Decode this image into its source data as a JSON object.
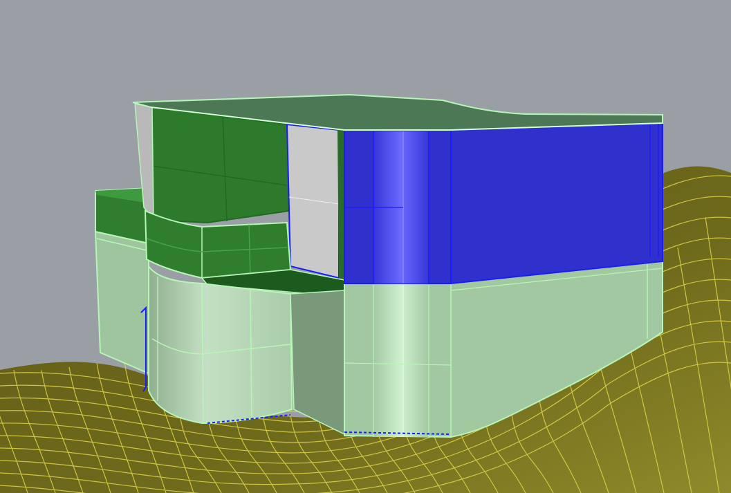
{
  "viewport": {
    "background_color": "#9a9fa6",
    "terrain": {
      "fill_color": "#6e6a1c",
      "highlight_color": "#8f8a2a",
      "grid_color": "#d9d04a"
    },
    "building": {
      "base_fill_color": "#a3c9a3",
      "base_fill_light": "#c8ebc8",
      "edge_highlight_color": "#b8f5b8",
      "selected_fill_color": "#3030cc",
      "selected_edge_color": "#1a1aff",
      "glass_fill_color": "#2f7d2f",
      "glass_dark_color": "#1f5f1f",
      "roof_color": "#4c7856",
      "opening_color": "#c9c9c9"
    }
  }
}
